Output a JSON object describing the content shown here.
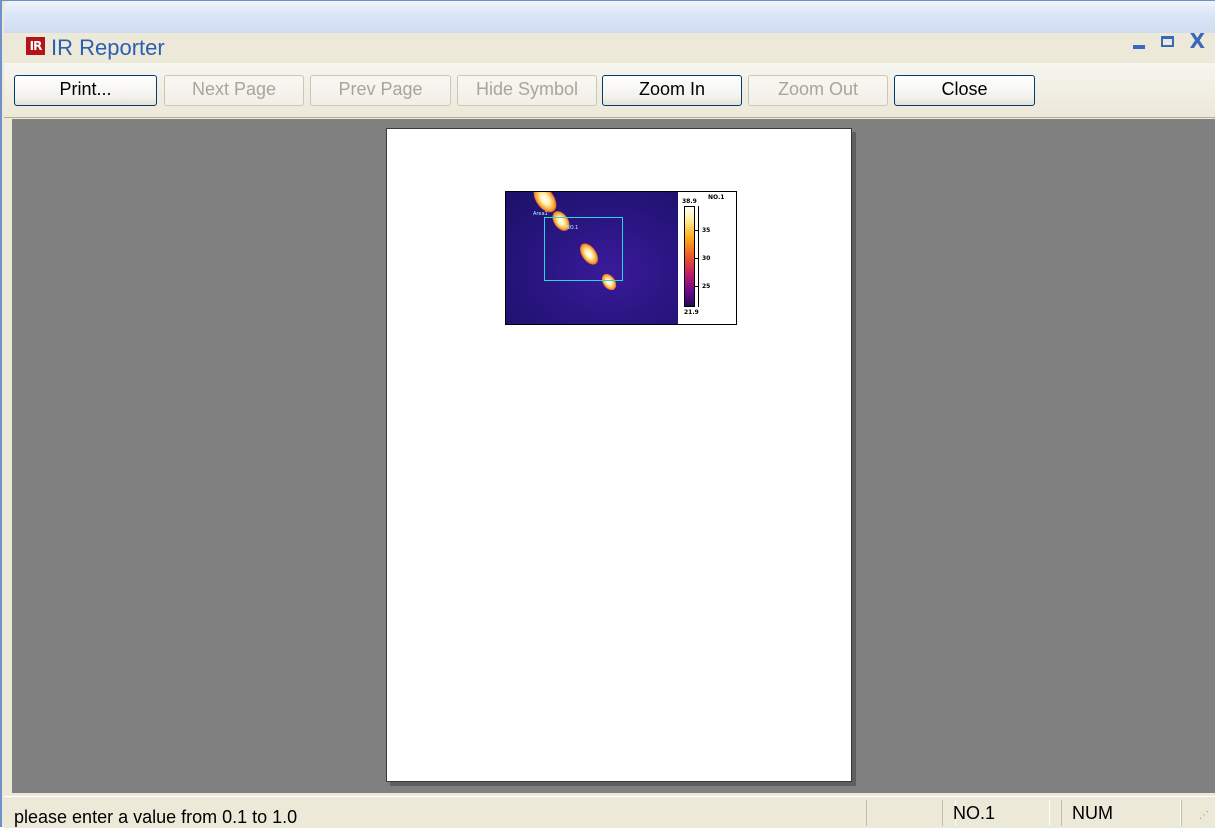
{
  "window": {
    "app_icon_text": "IR",
    "title": "IR Reporter",
    "icons": {
      "app": "ir-app-icon",
      "minimize": "minimize-icon",
      "maximize": "maximize-icon",
      "close": "close-icon"
    },
    "close_glyph": "X"
  },
  "toolbar": {
    "buttons": [
      {
        "label": "Print...",
        "enabled": true
      },
      {
        "label": "Next Page",
        "enabled": false
      },
      {
        "label": "Prev Page",
        "enabled": false
      },
      {
        "label": "Hide Symbol",
        "enabled": false
      },
      {
        "label": "Zoom In",
        "enabled": true
      },
      {
        "label": "Zoom Out",
        "enabled": false
      },
      {
        "label": "Close",
        "enabled": true
      }
    ]
  },
  "preview": {
    "thermal_image": {
      "roi_label_a": "Area1",
      "roi_label_b": "NO.1",
      "scale_title": "NO.1",
      "scale_max": "38.9",
      "scale_min": "21.9",
      "ticks": [
        "35",
        "30",
        "25"
      ]
    }
  },
  "statusbar": {
    "message": "please enter a value from 0.1 to 1.0",
    "panes": [
      "NO.1",
      "NUM",
      ""
    ]
  },
  "colors": {
    "window_frame": "#6f90c8",
    "client_background": "#808080",
    "roi_border": "#29d6e8",
    "title_text": "#2b5fb4"
  }
}
